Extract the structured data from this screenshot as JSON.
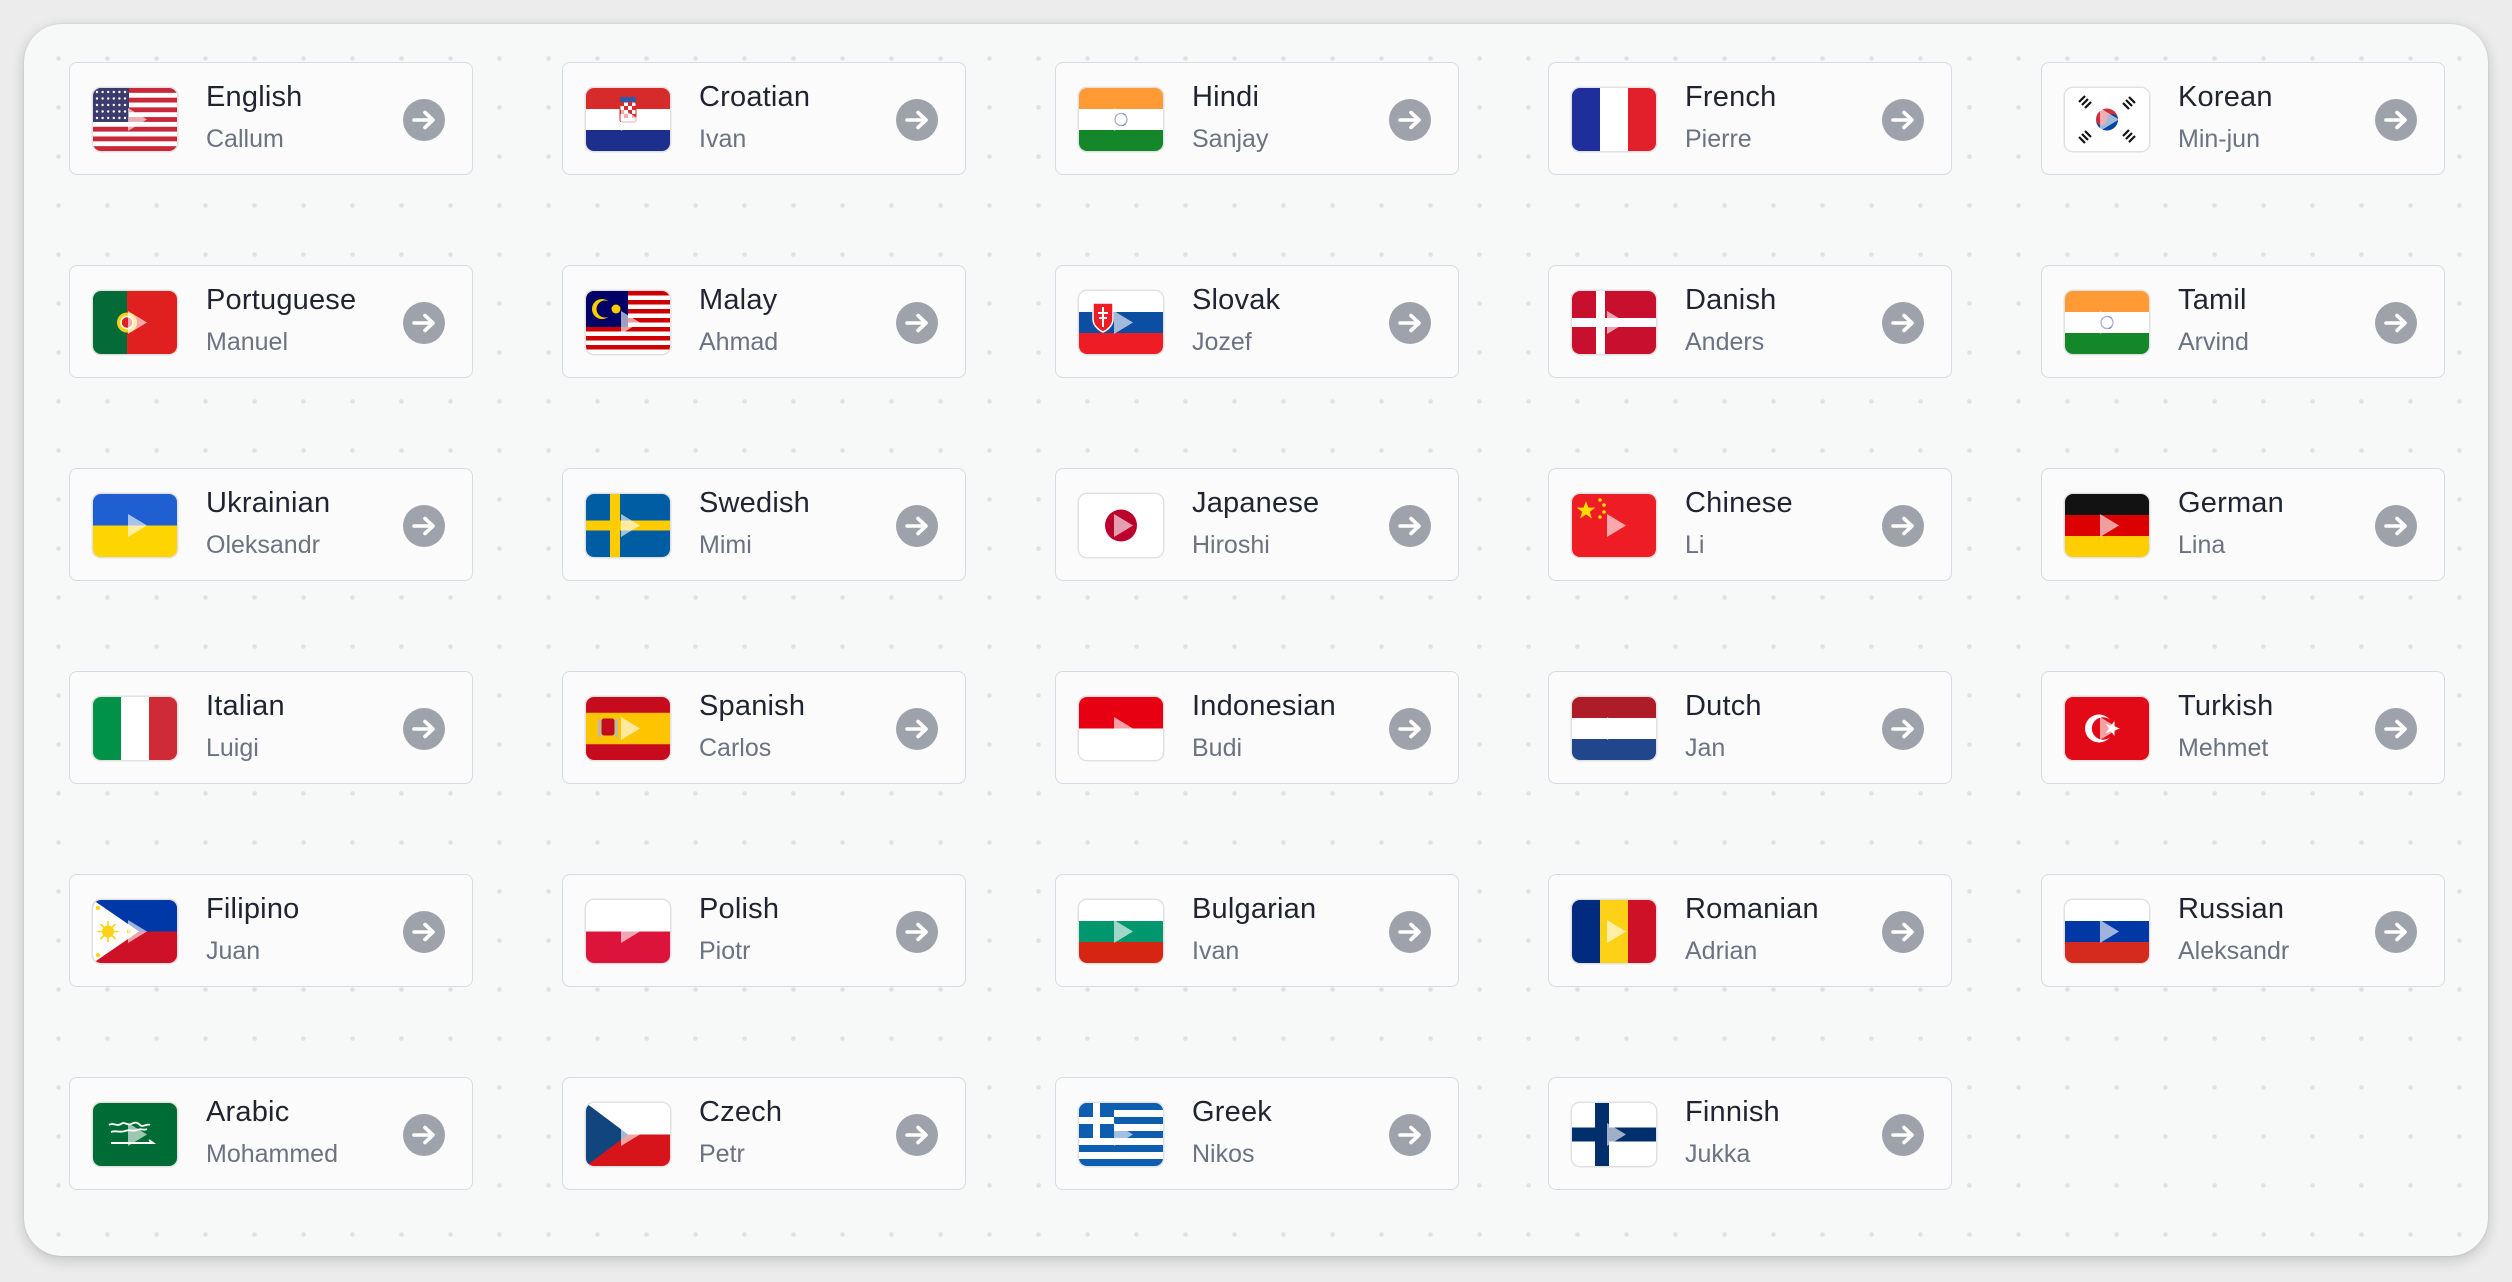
{
  "voices": [
    {
      "language": "English",
      "voice": "Callum",
      "flag": "us"
    },
    {
      "language": "Croatian",
      "voice": "Ivan",
      "flag": "hr"
    },
    {
      "language": "Hindi",
      "voice": "Sanjay",
      "flag": "in"
    },
    {
      "language": "French",
      "voice": "Pierre",
      "flag": "fr"
    },
    {
      "language": "Korean",
      "voice": "Min-jun",
      "flag": "kr"
    },
    {
      "language": "Portuguese",
      "voice": "Manuel",
      "flag": "pt"
    },
    {
      "language": "Malay",
      "voice": "Ahmad",
      "flag": "my"
    },
    {
      "language": "Slovak",
      "voice": "Jozef",
      "flag": "sk"
    },
    {
      "language": "Danish",
      "voice": "Anders",
      "flag": "dk"
    },
    {
      "language": "Tamil",
      "voice": "Arvind",
      "flag": "in"
    },
    {
      "language": "Ukrainian",
      "voice": "Oleksandr",
      "flag": "ua"
    },
    {
      "language": "Swedish",
      "voice": "Mimi",
      "flag": "se"
    },
    {
      "language": "Japanese",
      "voice": "Hiroshi",
      "flag": "jp"
    },
    {
      "language": "Chinese",
      "voice": "Li",
      "flag": "cn"
    },
    {
      "language": "German",
      "voice": "Lina",
      "flag": "de"
    },
    {
      "language": "Italian",
      "voice": "Luigi",
      "flag": "it"
    },
    {
      "language": "Spanish",
      "voice": "Carlos",
      "flag": "es"
    },
    {
      "language": "Indonesian",
      "voice": "Budi",
      "flag": "id"
    },
    {
      "language": "Dutch",
      "voice": "Jan",
      "flag": "nl"
    },
    {
      "language": "Turkish",
      "voice": "Mehmet",
      "flag": "tr"
    },
    {
      "language": "Filipino",
      "voice": "Juan",
      "flag": "ph"
    },
    {
      "language": "Polish",
      "voice": "Piotr",
      "flag": "pl"
    },
    {
      "language": "Bulgarian",
      "voice": "Ivan",
      "flag": "bg"
    },
    {
      "language": "Romanian",
      "voice": "Adrian",
      "flag": "ro"
    },
    {
      "language": "Russian",
      "voice": "Aleksandr",
      "flag": "ru"
    },
    {
      "language": "Arabic",
      "voice": "Mohammed",
      "flag": "sa"
    },
    {
      "language": "Czech",
      "voice": "Petr",
      "flag": "cz"
    },
    {
      "language": "Greek",
      "voice": "Nikos",
      "flag": "gr"
    },
    {
      "language": "Finnish",
      "voice": "Jukka",
      "flag": "fi"
    }
  ],
  "icons": {
    "play": "play-icon",
    "navigate": "arrow-right-circle-icon"
  },
  "colors": {
    "panel": "#f7f8f8",
    "card_border": "#d8dbe0",
    "arrow_button": "#9ea2ab",
    "language_text": "#1f2430",
    "voice_text": "#6b7280"
  }
}
